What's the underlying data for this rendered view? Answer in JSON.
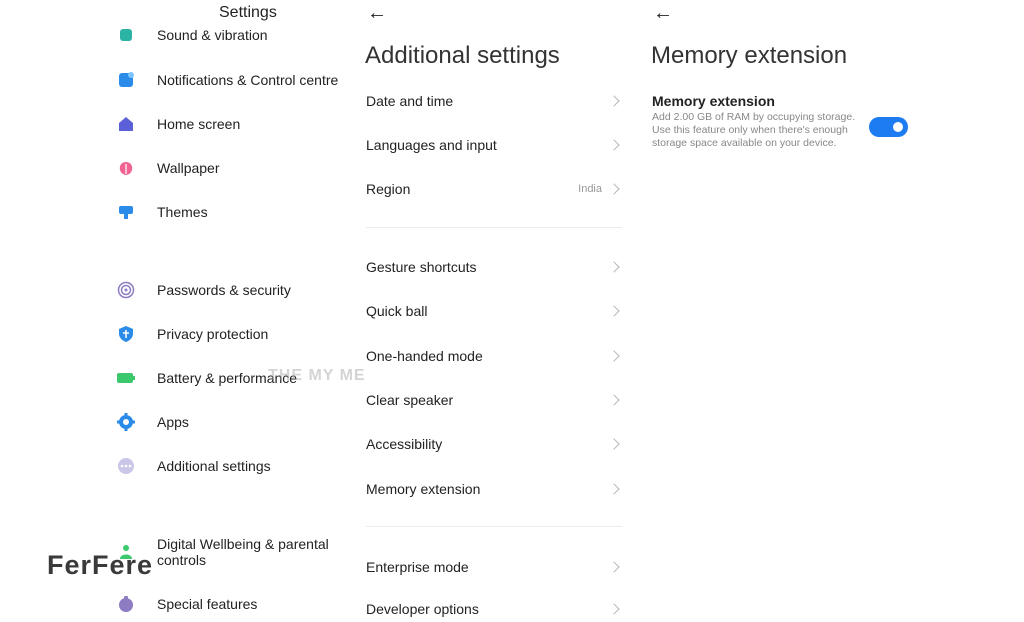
{
  "panel1": {
    "title": "Settings",
    "items": [
      {
        "label": "Sound & vibration"
      },
      {
        "label": "Notifications & Control centre"
      },
      {
        "label": "Home screen"
      },
      {
        "label": "Wallpaper"
      },
      {
        "label": "Themes"
      },
      {
        "label": "Passwords & security"
      },
      {
        "label": "Privacy protection"
      },
      {
        "label": "Battery & performance"
      },
      {
        "label": "Apps"
      },
      {
        "label": "Additional settings"
      },
      {
        "label": "Digital Wellbeing & parental controls"
      },
      {
        "label": "Special features"
      }
    ]
  },
  "panel2": {
    "title": "Additional settings",
    "rows": [
      {
        "label": "Date and time"
      },
      {
        "label": "Languages and input"
      },
      {
        "label": "Region",
        "value": "India"
      },
      {
        "label": "Gesture shortcuts"
      },
      {
        "label": "Quick ball"
      },
      {
        "label": "One-handed mode"
      },
      {
        "label": "Clear speaker"
      },
      {
        "label": "Accessibility"
      },
      {
        "label": "Memory extension"
      },
      {
        "label": "Enterprise mode"
      },
      {
        "label": "Developer options"
      }
    ]
  },
  "panel3": {
    "title": "Memory extension",
    "setting": {
      "title": "Memory extension",
      "description": "Add 2.00 GB of RAM by occupying storage. Use this feature only when there's enough storage space available on your device.",
      "enabled": true
    }
  },
  "watermarks": {
    "center": "THE MY ME",
    "logo": "FerFere"
  },
  "colors": {
    "toggle_on": "#1e7cf2",
    "icon_teal": "#2bb3a3",
    "icon_blue": "#2a8ce8",
    "icon_indigo": "#5b5fd8",
    "icon_pink": "#f06292",
    "icon_purple": "#8e7cc3",
    "icon_green": "#3cc86d"
  }
}
